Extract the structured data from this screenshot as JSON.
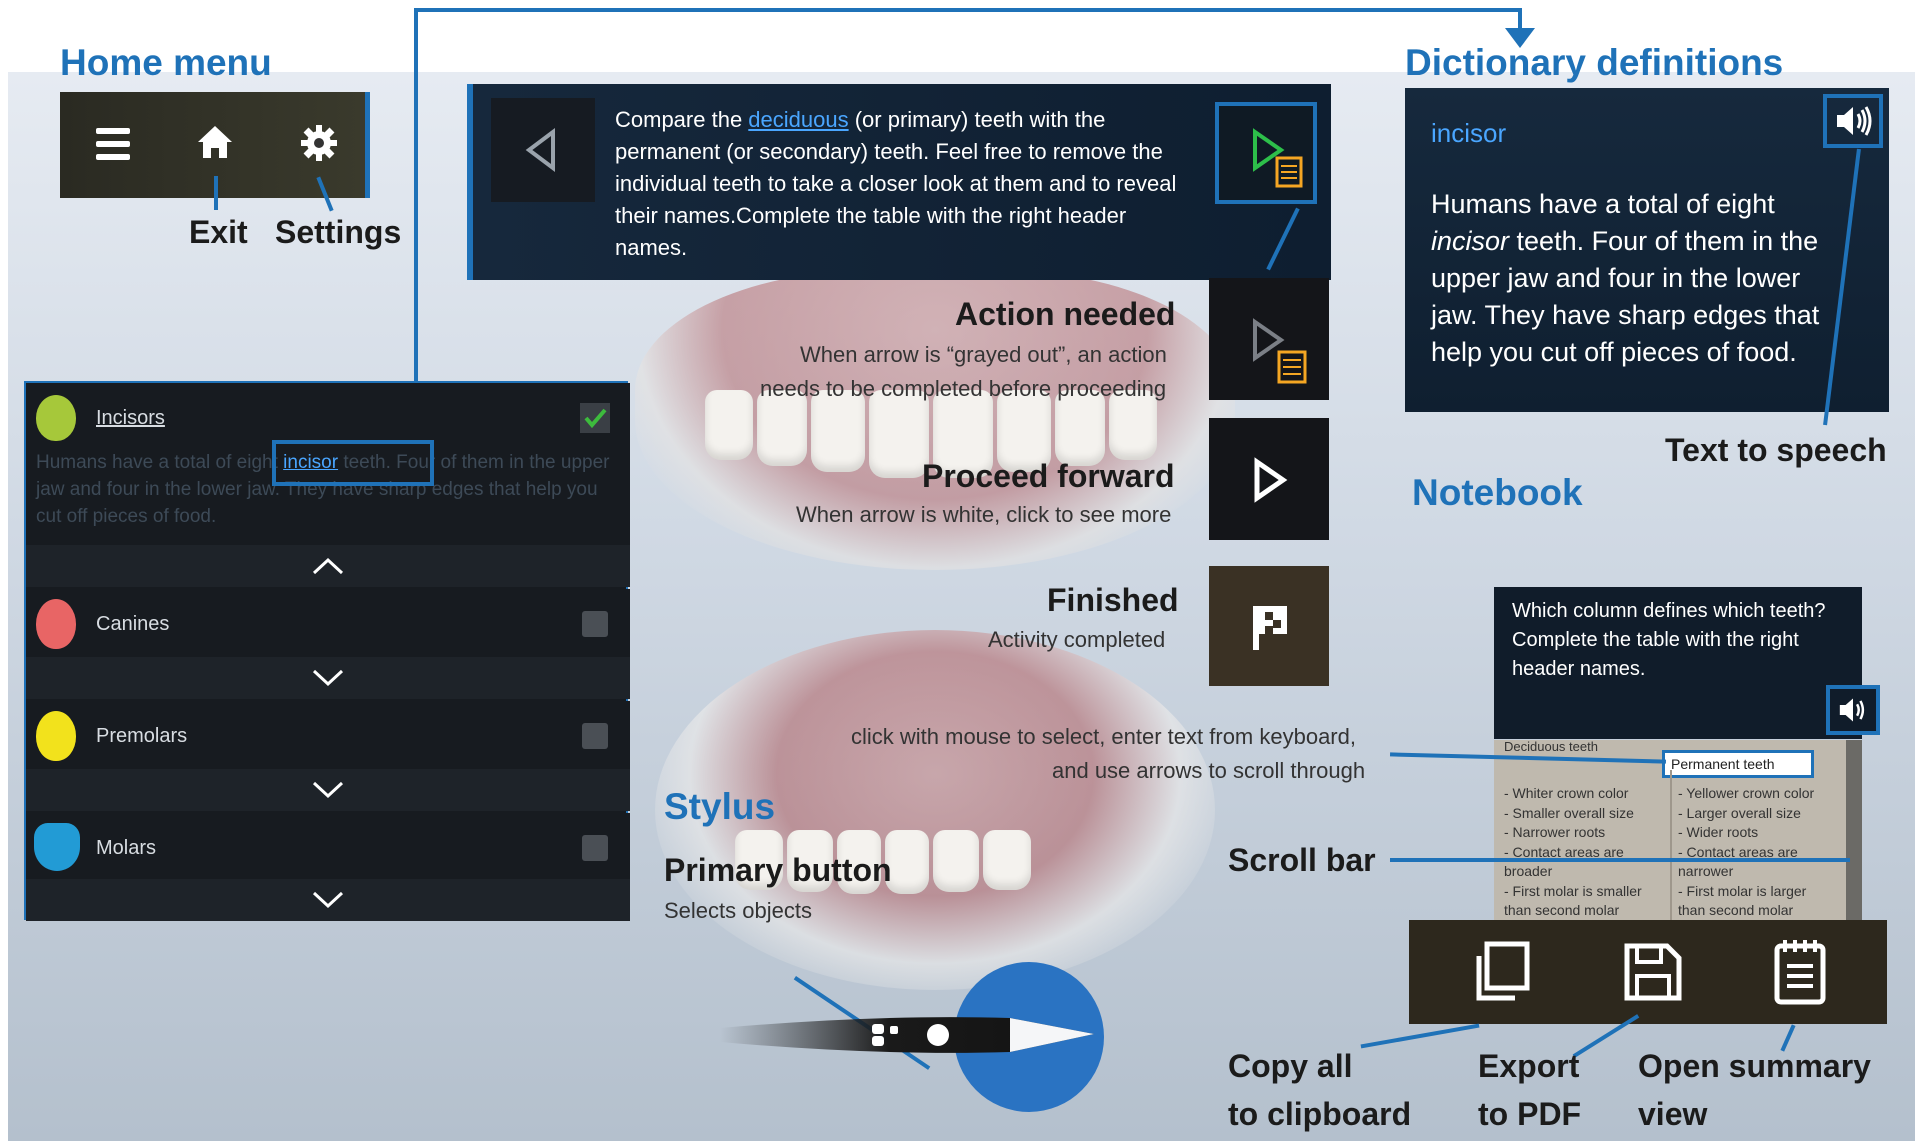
{
  "home_menu": {
    "title": "Home menu",
    "exit_label": "Exit",
    "settings_label": "Settings"
  },
  "instruction": {
    "pre": "Compare the ",
    "link": "deciduous",
    "post": " (or primary) teeth with the permanent (or secondary) teeth. Feel free to remove the individual teeth to take a closer look at them and to reveal their names.Complete the table with the right header names."
  },
  "dictionary": {
    "title": "Dictionary definitions",
    "term": "incisor",
    "def_pre": "Humans have a total of eight ",
    "def_em": "incisor",
    "def_post": " teeth. Four of them in the upper jaw and four in the lower jaw. They have sharp edges that help you cut off pieces of food.",
    "tts_label": "Text to speech"
  },
  "states": {
    "action_title": "Action needed",
    "action_desc1": "When arrow is “grayed out”, an action",
    "action_desc2": "needs to be completed before proceeding",
    "proceed_title": "Proceed forward",
    "proceed_desc": "When arrow is white, click to see more",
    "finished_title": "Finished",
    "finished_desc": "Activity completed"
  },
  "sidebar": {
    "items": [
      {
        "label": "Incisors",
        "color": "#a6c83a",
        "checked": true
      },
      {
        "label": "Canines",
        "color": "#e86565",
        "checked": false
      },
      {
        "label": "Premolars",
        "color": "#f2e21c",
        "checked": false
      },
      {
        "label": "Molars",
        "color": "#229bd5",
        "checked": false
      }
    ],
    "desc_pre": "Humans have a total of eight ",
    "desc_link": "incisor",
    "desc_post": " teeth. Four of them in the upper jaw and four in the lower jaw. They have sharp edges that help you cut off pieces of food."
  },
  "notebook": {
    "title": "Notebook",
    "question": "Which column defines which teeth? Complete the table with the right header names.",
    "col1_header": "Deciduous teeth",
    "col2_header": "Permanent teeth",
    "col1_lines": [
      "- Whiter crown color",
      "- Smaller overall size",
      "- Narrower roots",
      "- Contact areas are",
      "broader",
      "- First molar is smaller",
      "than second molar"
    ],
    "col2_lines": [
      "- Yellower crown color",
      "- Larger overall size",
      "- Wider roots",
      "- Contact areas are",
      "narrower",
      "- First molar is larger",
      "than second molar"
    ],
    "input_hint1": "click with mouse to select, enter text from keyboard,",
    "input_hint2": "and use arrows to scroll through",
    "scroll_label": "Scroll bar",
    "copy_label1": "Copy all",
    "copy_label2": "to clipboard",
    "export_label1": "Export",
    "export_label2": "to PDF",
    "summary_label1": "Open summary",
    "summary_label2": "view"
  },
  "stylus": {
    "title": "Stylus",
    "button_title": "Primary button",
    "button_desc": "Selects objects"
  },
  "colors": {
    "accent": "#1f72b8",
    "panel": "#132436",
    "green_arrow": "#2dbf4a",
    "orange_note": "#f5a623"
  }
}
